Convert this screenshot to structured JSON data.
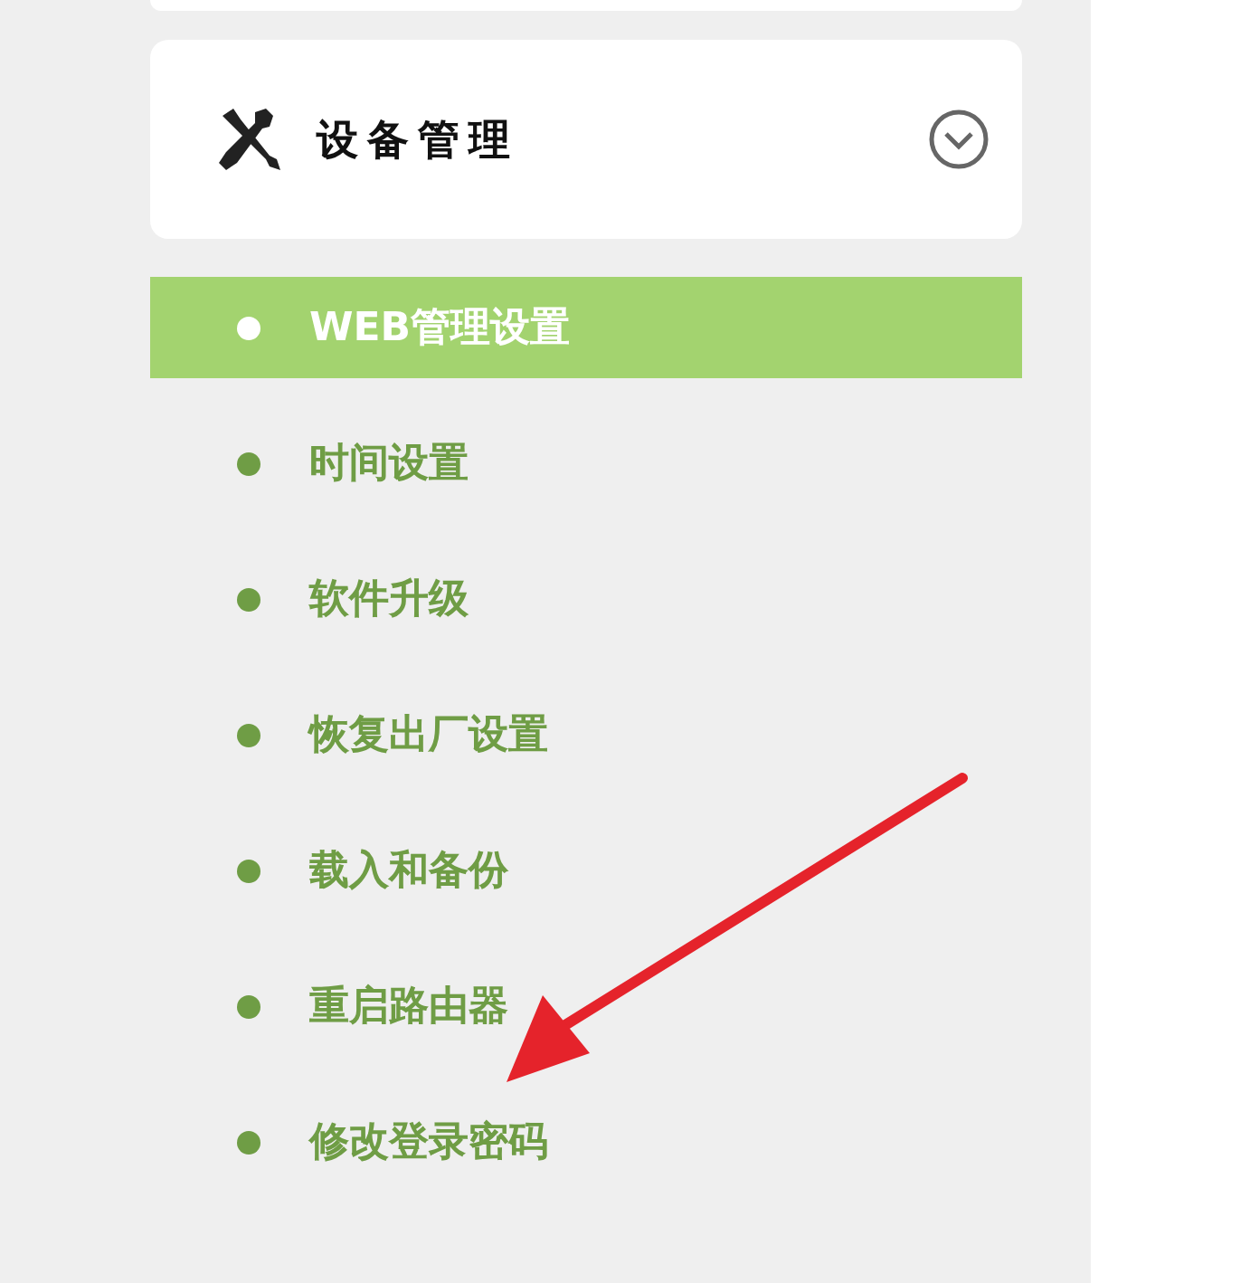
{
  "section": {
    "title": "设备管理",
    "expanded": true
  },
  "menu": [
    {
      "label": "WEB管理设置",
      "selected": true
    },
    {
      "label": "时间设置",
      "selected": false
    },
    {
      "label": "软件升级",
      "selected": false
    },
    {
      "label": "恢复出厂设置",
      "selected": false
    },
    {
      "label": "载入和备份",
      "selected": false
    },
    {
      "label": "重启路由器",
      "selected": false
    },
    {
      "label": "修改登录密码",
      "selected": false
    }
  ]
}
